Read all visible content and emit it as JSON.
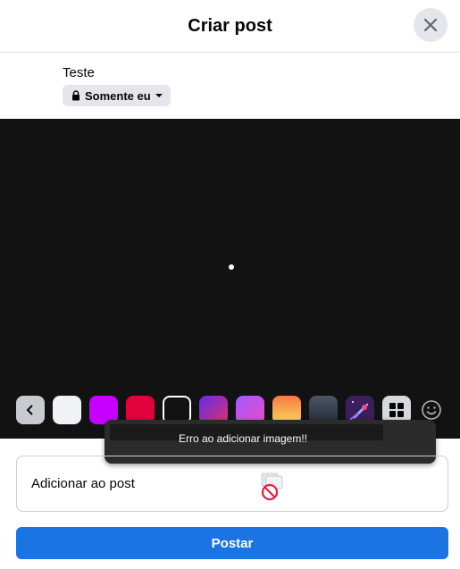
{
  "header": {
    "title": "Criar post",
    "close_icon": "close-icon"
  },
  "user": {
    "name": "Teste"
  },
  "privacy": {
    "label": "Somente eu",
    "lock_icon": "lock-icon",
    "caret_icon": "caret-down-icon"
  },
  "backgrounds": {
    "back_icon": "chevron-left-icon",
    "swatches": [
      {
        "id": "white",
        "fill": "#f0f2f5"
      },
      {
        "id": "purple",
        "fill": "#c600ff"
      },
      {
        "id": "red",
        "fill": "#e2013b"
      },
      {
        "id": "black",
        "fill": "#121212",
        "selected": true
      },
      {
        "id": "purple-magenta-gradient",
        "fill": "linear-gradient(135deg,#5f2eea,#e1306c)"
      },
      {
        "id": "magenta-purple-gradient",
        "fill": "linear-gradient(135deg,#9b5cff,#f049c6)"
      },
      {
        "id": "orange-gradient",
        "fill": "linear-gradient(180deg,#f57b42,#fcd75b)"
      },
      {
        "id": "gray-gradient",
        "fill": "linear-gradient(180deg,#4b5563,#1f2937)"
      },
      {
        "id": "space-illustration",
        "fill": "#3c1e5c"
      }
    ],
    "grid_icon": "grid-icon",
    "emoji_icon": "smiley-icon"
  },
  "toast": {
    "message": "Erro ao adicionar imagem!!"
  },
  "add_to_post": {
    "label": "Adicionar ao post",
    "photo_icon": "photo-unavailable-icon"
  },
  "actions": {
    "post_label": "Postar"
  },
  "colors": {
    "accent": "#1b74e4",
    "canvas": "#121212"
  }
}
